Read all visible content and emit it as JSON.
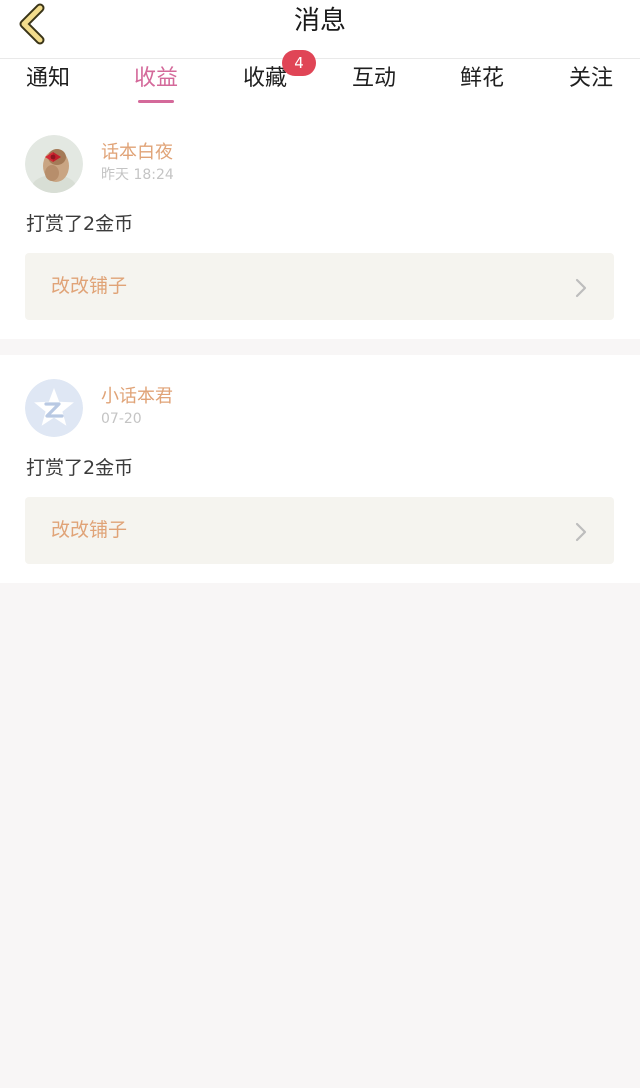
{
  "header": {
    "title": "消息",
    "back_icon": "chevron-left-icon"
  },
  "tabs": [
    {
      "label": "通知",
      "active": false
    },
    {
      "label": "收益",
      "active": true
    },
    {
      "label": "收藏",
      "active": false,
      "badge": "4"
    },
    {
      "label": "互动",
      "active": false
    },
    {
      "label": "鲜花",
      "active": false
    },
    {
      "label": "关注",
      "active": false
    }
  ],
  "messages": [
    {
      "user": "话本白夜",
      "time": "昨天 18:24",
      "action": "打赏了2金币",
      "shop": "改改铺子",
      "avatar_icon": "user-photo-avatar"
    },
    {
      "user": "小话本君",
      "time": "07-20",
      "action": "打赏了2金币",
      "shop": "改改铺子",
      "avatar_icon": "star-logo-avatar"
    }
  ],
  "colors": {
    "accent": "#d4699a",
    "badge": "#e04556",
    "name": "#e0a377",
    "background": "#f8f6f6"
  }
}
